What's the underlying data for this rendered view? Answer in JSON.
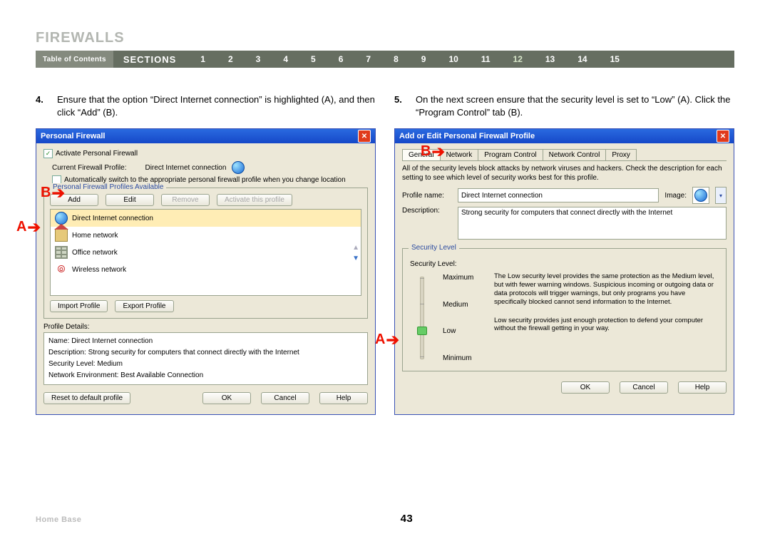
{
  "title": "FIREWALLS",
  "nav": {
    "toc": "Table of Contents",
    "sections_label": "SECTIONS",
    "numbers": [
      "1",
      "2",
      "3",
      "4",
      "5",
      "6",
      "7",
      "8",
      "9",
      "10",
      "11",
      "12",
      "13",
      "14",
      "15"
    ],
    "active": "12"
  },
  "step4": {
    "num": "4.",
    "text": "Ensure that the option “Direct Internet connection” is highlighted (A), and then click “Add” (B)."
  },
  "step5": {
    "num": "5.",
    "text": "On the next screen ensure that the security level is set to “Low” (A). Click the “Program Control” tab (B)."
  },
  "win1": {
    "title": "Personal Firewall",
    "activate": "Activate Personal Firewall",
    "cur_profile_label": "Current Firewall Profile:",
    "cur_profile_value": "Direct Internet connection",
    "auto_switch": "Automatically switch to the appropriate personal firewall profile when you change location",
    "profiles_legend": "Personal Firewall Profiles Available",
    "btn_add": "Add",
    "btn_edit": "Edit",
    "btn_remove": "Remove",
    "btn_activate": "Activate this profile",
    "items": {
      "direct": "Direct Internet connection",
      "home": "Home network",
      "office": "Office network",
      "wireless": "Wireless network"
    },
    "btn_import": "Import Profile",
    "btn_export": "Export Profile",
    "details_label": "Profile Details:",
    "d_name": "Name: Direct Internet connection",
    "d_desc": "Description: Strong security for computers that connect directly with the Internet",
    "d_sec": "Security Level: Medium",
    "d_env": "Network Environment: Best Available Connection",
    "btn_reset": "Reset to default profile",
    "btn_ok": "OK",
    "btn_cancel": "Cancel",
    "btn_help": "Help"
  },
  "win2": {
    "title": "Add or Edit Personal Firewall Profile",
    "tabs": {
      "general": "General",
      "network": "Network",
      "program": "Program Control",
      "netctrl": "Network Control",
      "proxy": "Proxy"
    },
    "note": "All of the security levels block attacks by network viruses and hackers. Check the description for each setting to see which level of security works best for this profile.",
    "lbl_profile_name": "Profile name:",
    "profile_name": "Direct Internet connection",
    "lbl_image": "Image:",
    "lbl_description": "Description:",
    "description": "Strong security for computers that connect directly with the Internet",
    "sec_legend": "Security Level",
    "sec_label": "Security Level:",
    "levels": {
      "max": "Maximum",
      "med": "Medium",
      "low": "Low",
      "min": "Minimum"
    },
    "desc_max": "The Low security level provides the same protection as the Medium level, but with fewer warning windows. Suspicious incoming or outgoing data or data protocols will trigger warnings, but only programs you have specifically blocked cannot send information to the Internet.",
    "desc_low": "Low security provides just enough protection to defend your computer without the firewall getting in your way.",
    "btn_ok": "OK",
    "btn_cancel": "Cancel",
    "btn_help": "Help"
  },
  "callouts": {
    "A": "A",
    "B": "B"
  },
  "footer": {
    "brand": "Home Base",
    "page": "43"
  }
}
